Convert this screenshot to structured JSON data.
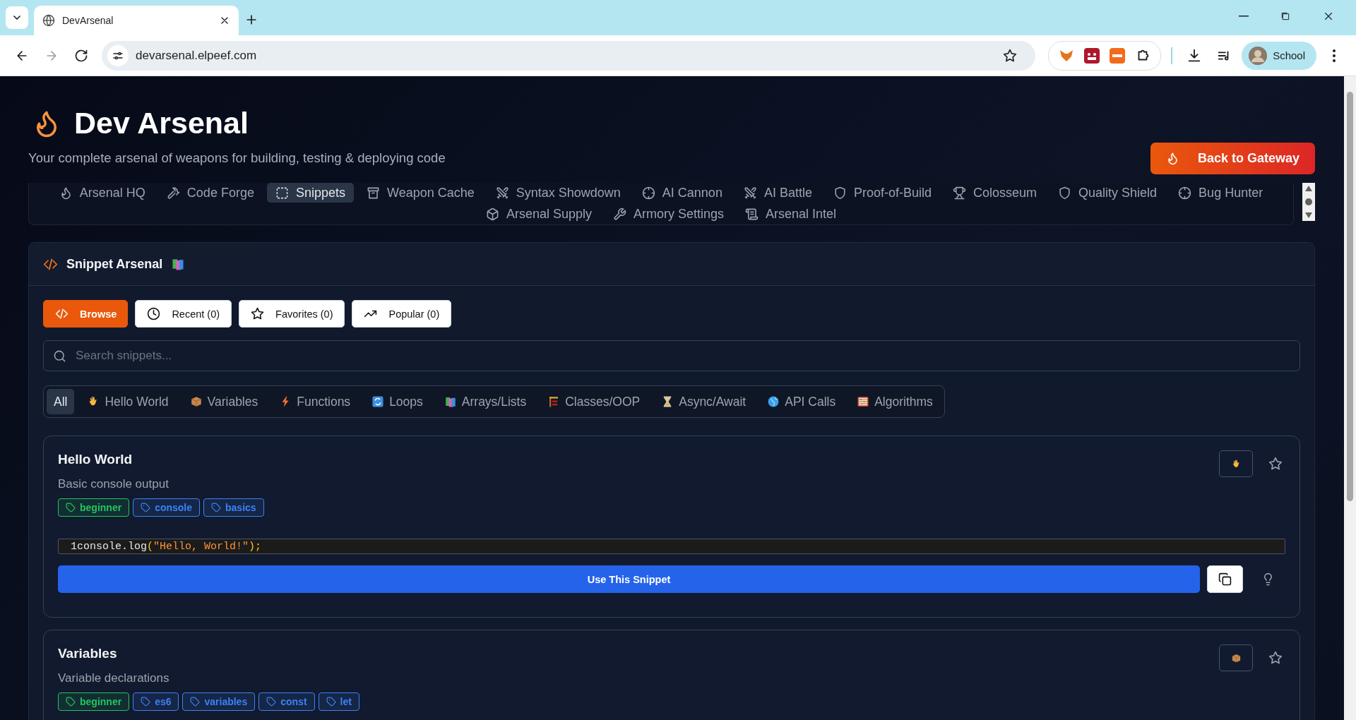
{
  "browser": {
    "tab_title": "DevArsenal",
    "url": "devarsenal.elpeef.com",
    "profile": "School"
  },
  "header": {
    "title": "Dev Arsenal",
    "subtitle": "Your complete arsenal of weapons for building, testing & deploying code",
    "action": "Back to Gateway"
  },
  "nav": [
    {
      "label": "Arsenal HQ",
      "selected": false
    },
    {
      "label": "Code Forge",
      "selected": false
    },
    {
      "label": "Snippets",
      "selected": true
    },
    {
      "label": "Weapon Cache",
      "selected": false
    },
    {
      "label": "Syntax Showdown",
      "selected": false
    },
    {
      "label": "AI Cannon",
      "selected": false
    },
    {
      "label": "AI Battle",
      "selected": false
    },
    {
      "label": "Proof-of-Build",
      "selected": false
    },
    {
      "label": "Colosseum",
      "selected": false
    },
    {
      "label": "Quality Shield",
      "selected": false
    },
    {
      "label": "Bug Hunter",
      "selected": false
    },
    {
      "label": "Arsenal Supply",
      "selected": false
    },
    {
      "label": "Armory Settings",
      "selected": false
    },
    {
      "label": "Arsenal Intel",
      "selected": false
    }
  ],
  "panel": {
    "title": "Snippet Arsenal",
    "views": [
      {
        "label": "Browse",
        "selected": true
      },
      {
        "label": "Recent (0)",
        "selected": false
      },
      {
        "label": "Favorites (0)",
        "selected": false
      },
      {
        "label": "Popular (0)",
        "selected": false
      }
    ],
    "search": {
      "placeholder": "Search snippets..."
    },
    "categories": [
      {
        "label": "All",
        "selected": true
      },
      {
        "label": "Hello World",
        "selected": false
      },
      {
        "label": "Variables",
        "selected": false
      },
      {
        "label": "Functions",
        "selected": false
      },
      {
        "label": "Loops",
        "selected": false
      },
      {
        "label": "Arrays/Lists",
        "selected": false
      },
      {
        "label": "Classes/OOP",
        "selected": false
      },
      {
        "label": "Async/Await",
        "selected": false
      },
      {
        "label": "API Calls",
        "selected": false
      },
      {
        "label": "Algorithms",
        "selected": false
      }
    ],
    "snippets": [
      {
        "title": "Hello World",
        "description": "Basic console output",
        "favorite": false,
        "tags": [
          {
            "label": "beginner",
            "color": "#22c55e"
          },
          {
            "label": "console",
            "color": "#3b82f6"
          },
          {
            "label": "basics",
            "color": "#3b82f6"
          }
        ],
        "code": {
          "line_number": "1",
          "tokens": [
            {
              "text": "console.log",
              "kind": "plain"
            },
            {
              "text": "(",
              "kind": "punct"
            },
            {
              "text": "\"Hello, World!\"",
              "kind": "string"
            },
            {
              "text": ");",
              "kind": "punct"
            }
          ]
        },
        "action": "Use This Snippet"
      },
      {
        "title": "Variables",
        "description": "Variable declarations",
        "favorite": false,
        "tags": [
          {
            "label": "beginner",
            "color": "#22c55e"
          },
          {
            "label": "es6",
            "color": "#3b82f6"
          },
          {
            "label": "variables",
            "color": "#3b82f6"
          },
          {
            "label": "const",
            "color": "#3b82f6"
          },
          {
            "label": "let",
            "color": "#3b82f6"
          }
        ]
      }
    ]
  }
}
